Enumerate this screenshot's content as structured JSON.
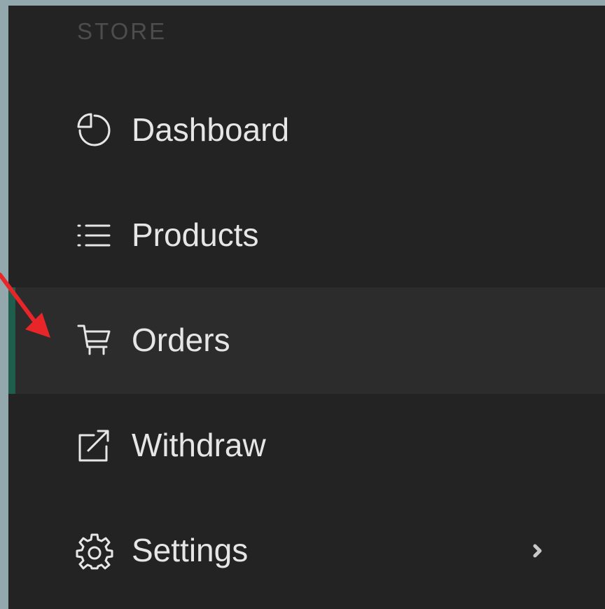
{
  "sidebar": {
    "section_label": "STORE",
    "items": [
      {
        "label": "Dashboard",
        "icon": "pie-chart-icon",
        "active": false
      },
      {
        "label": "Products",
        "icon": "list-icon",
        "active": false
      },
      {
        "label": "Orders",
        "icon": "cart-icon",
        "active": true
      },
      {
        "label": "Withdraw",
        "icon": "external-link-icon",
        "active": false
      },
      {
        "label": "Settings",
        "icon": "gear-icon",
        "active": false,
        "has_submenu": true
      }
    ]
  },
  "colors": {
    "frame_background": "#93a8ad",
    "sidebar_background": "#232323",
    "active_item_background": "#2c2c2c",
    "active_indicator": "#1f5e4c",
    "text": "#e6e6e6",
    "section_label": "#4d4d4d",
    "annotation_arrow": "#e8262a"
  }
}
